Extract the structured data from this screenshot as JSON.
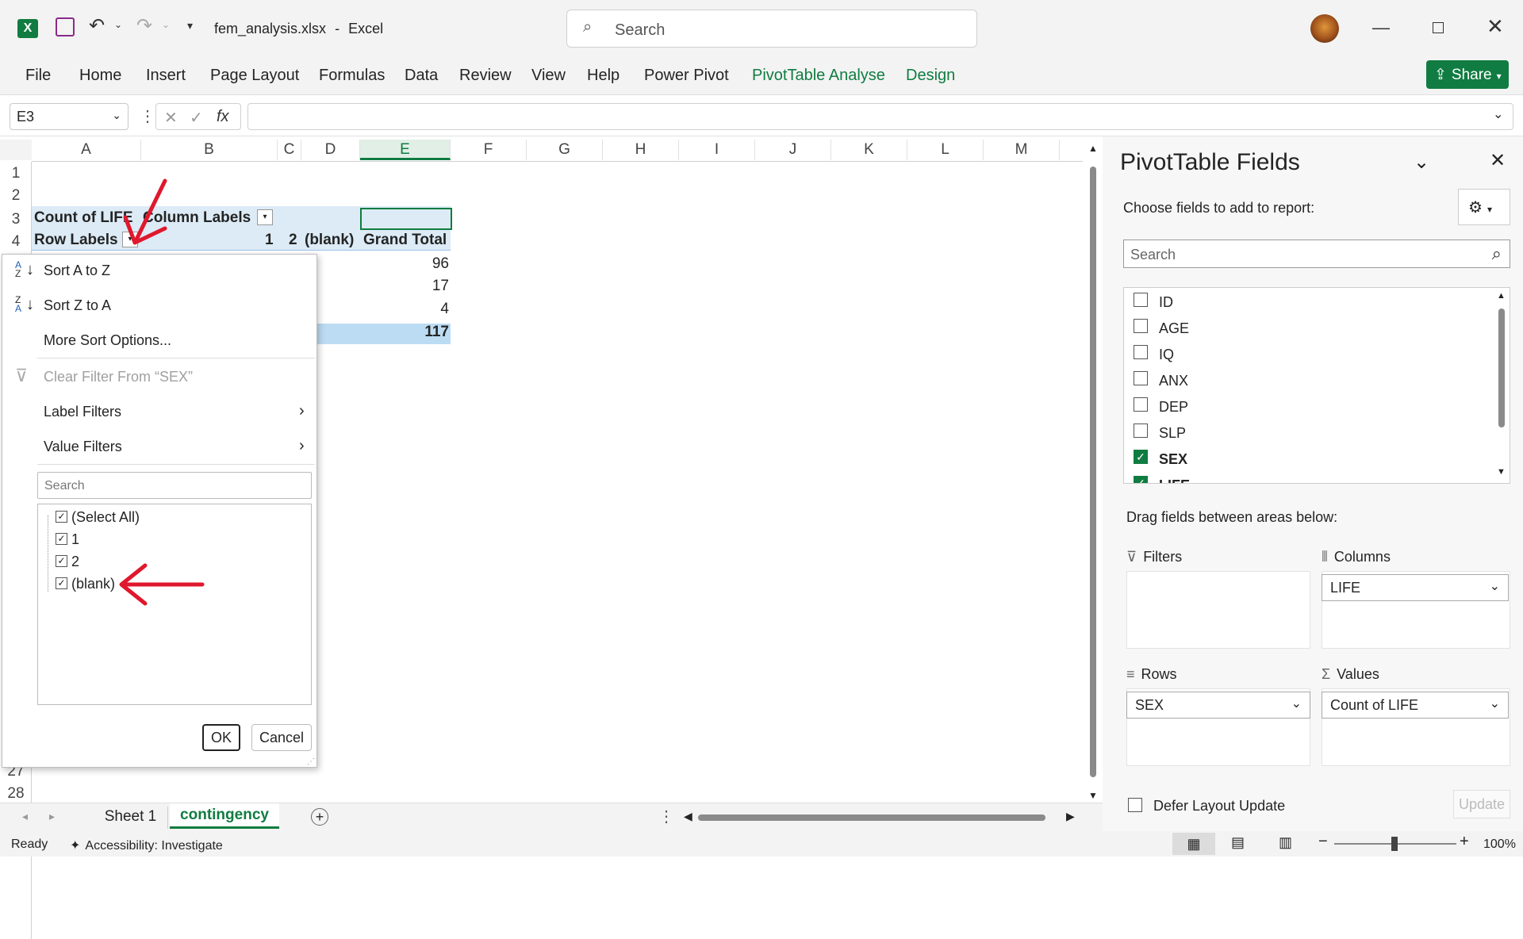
{
  "app": {
    "filename": "fem_analysis.xlsx",
    "separator": "-",
    "app_name": "Excel",
    "search_placeholder": "Search",
    "share_label": "Share",
    "accent": "#107c41"
  },
  "ribbon_tabs": [
    "File",
    "Home",
    "Insert",
    "Page Layout",
    "Formulas",
    "Data",
    "Review",
    "View",
    "Help",
    "Power Pivot",
    "PivotTable Analyse",
    "Design"
  ],
  "formula_bar": {
    "name_box": "E3",
    "fx": "fx",
    "value": ""
  },
  "columns": [
    "A",
    "B",
    "C",
    "D",
    "E",
    "F",
    "G",
    "H",
    "I",
    "J",
    "K",
    "L",
    "M"
  ],
  "rows": [
    "1",
    "2",
    "3",
    "4",
    "27",
    "28"
  ],
  "pivot": {
    "a3": "Count of LIFE",
    "b3": "Column Labels",
    "a4": "Row Labels",
    "b4": "1",
    "c4": "2",
    "d4": "(blank)",
    "e4": "Grand Total",
    "totals": [
      "96",
      "17",
      "4",
      "117"
    ]
  },
  "filter_menu": {
    "sort_az": "Sort A to Z",
    "sort_za": "Sort Z to A",
    "more_sort": "More Sort Options...",
    "clear_filter": "Clear Filter From “SEX”",
    "label_filters": "Label Filters",
    "value_filters": "Value Filters",
    "search_placeholder": "Search",
    "items": [
      "(Select All)",
      "1",
      "2",
      "(blank)"
    ],
    "ok": "OK",
    "cancel": "Cancel"
  },
  "pivot_panel": {
    "title": "PivotTable Fields",
    "subtitle": "Choose fields to add to report:",
    "search_placeholder": "Search",
    "fields": [
      {
        "name": "ID",
        "checked": false
      },
      {
        "name": "AGE",
        "checked": false
      },
      {
        "name": "IQ",
        "checked": false
      },
      {
        "name": "ANX",
        "checked": false
      },
      {
        "name": "DEP",
        "checked": false
      },
      {
        "name": "SLP",
        "checked": false
      },
      {
        "name": "SEX",
        "checked": true
      },
      {
        "name": "LIFE",
        "checked": true
      }
    ],
    "drag_hint": "Drag fields between areas below:",
    "filters_label": "Filters",
    "columns_label": "Columns",
    "rows_label": "Rows",
    "values_label": "Values",
    "columns_value": "LIFE",
    "rows_value": "SEX",
    "values_value": "Count of LIFE",
    "defer_label": "Defer Layout Update",
    "update_label": "Update"
  },
  "sheets": [
    "Sheet 1",
    "contingency"
  ],
  "status": {
    "ready": "Ready",
    "accessibility": "Accessibility: Investigate",
    "zoom": "100%"
  }
}
